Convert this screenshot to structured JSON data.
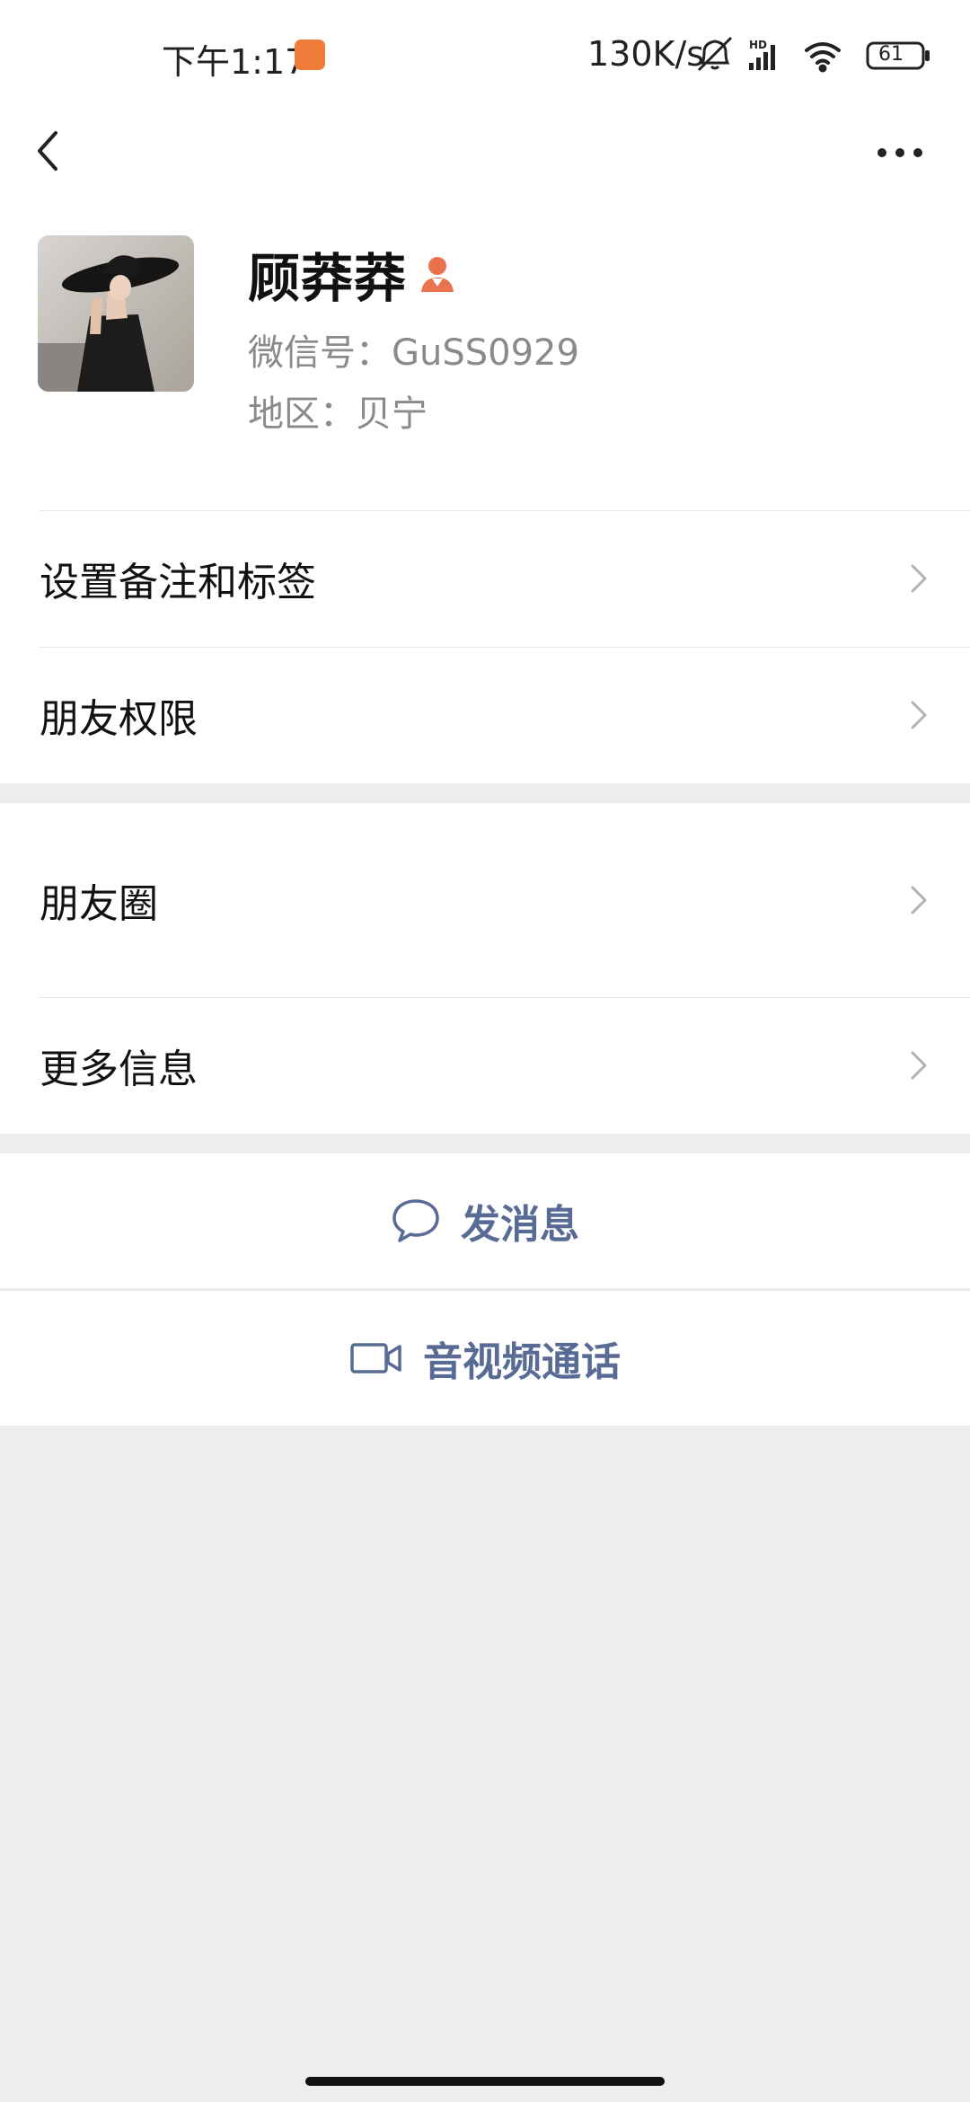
{
  "status_bar": {
    "time": "下午1:17",
    "net_speed": "130K/s",
    "battery": "61",
    "icons": [
      "app-notification-icon",
      "mute-bell-icon",
      "hd-signal-icon",
      "wifi-icon",
      "battery-icon"
    ]
  },
  "nav": {
    "back_icon": "chevron-left-icon",
    "more_icon": "more-dots-icon"
  },
  "profile": {
    "name": "顾莽莽",
    "wechat_id": "微信号：GuSS0929",
    "region": "地区：贝宁",
    "badge_icon": "person-badge-icon",
    "badge_color": "#e8734c"
  },
  "menu_a": [
    {
      "label": "设置备注和标签"
    },
    {
      "label": "朋友权限"
    }
  ],
  "menu_b": [
    {
      "label": "朋友圈"
    },
    {
      "label": "更多信息"
    }
  ],
  "actions": {
    "message": {
      "label": "发消息",
      "icon": "chat-bubble-icon"
    },
    "call": {
      "label": "音视频通话",
      "icon": "video-camera-icon"
    }
  },
  "colors": {
    "link": "#576b95",
    "background": "#ededed",
    "app_icon": "#f07c3a"
  }
}
